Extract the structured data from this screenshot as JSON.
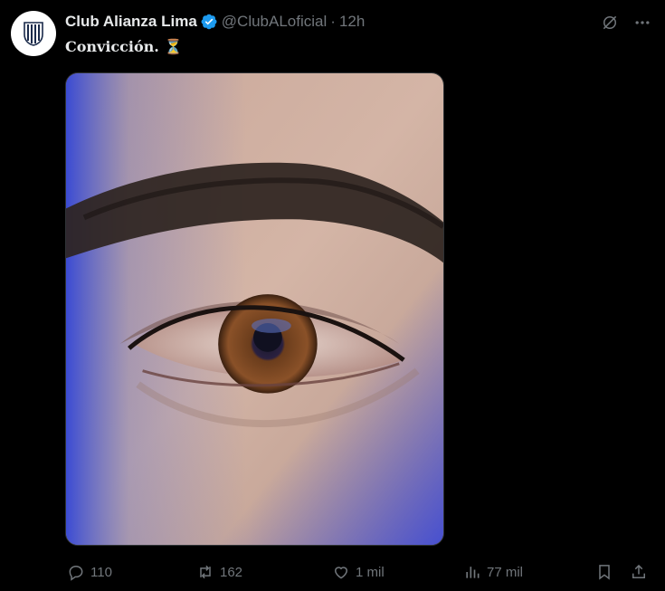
{
  "tweet": {
    "author_name": "Club Alianza Lima",
    "handle": "@ClubALoficial",
    "separator": "·",
    "time": "12h",
    "text": "Convicción.",
    "emoji": "⏳",
    "media_icon": "eye-closeup-photo"
  },
  "actions": {
    "replies": "110",
    "retweets": "162",
    "likes": "1 mil",
    "views": "77 mil"
  },
  "icons": {
    "grok": "grok-icon",
    "more": "more-icon",
    "verified": "verified-badge-icon",
    "reply": "reply-icon",
    "retweet": "retweet-icon",
    "like": "like-icon",
    "views": "views-icon",
    "bookmark": "bookmark-icon",
    "share": "share-icon"
  },
  "colors": {
    "background": "#000000",
    "text": "#e7e9ea",
    "secondary": "#71767b",
    "verified": "#1d9bf0"
  }
}
